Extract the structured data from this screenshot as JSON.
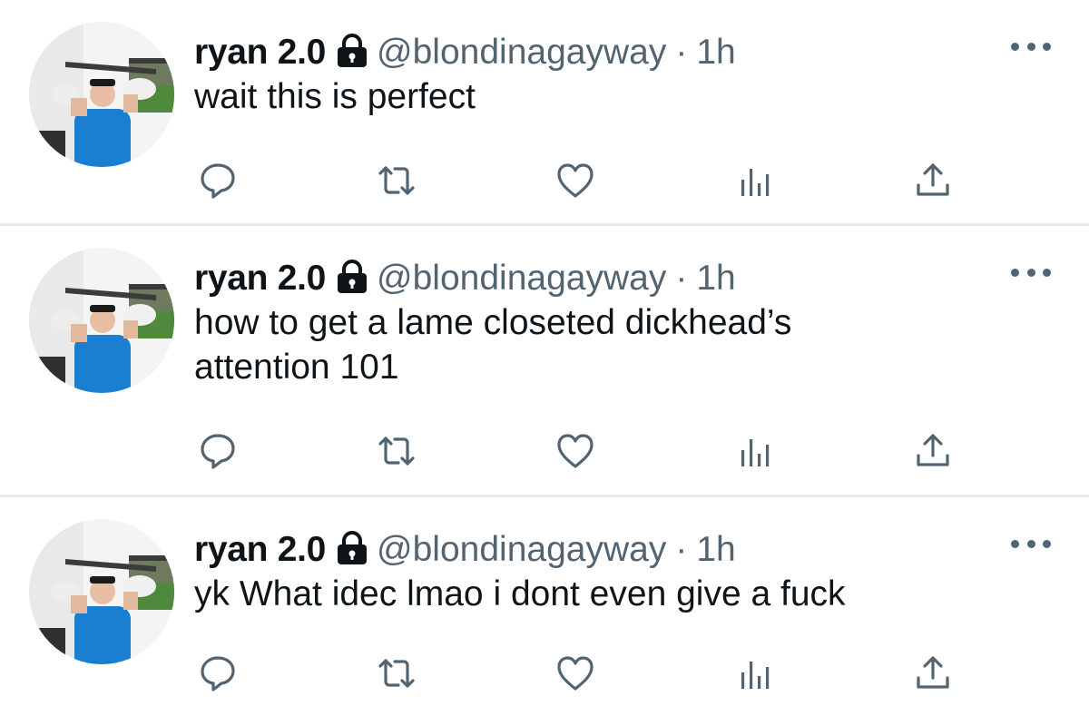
{
  "colors": {
    "name": "#0f1419",
    "secondary": "#536471",
    "divider": "#e8eaed",
    "background": "#ffffff"
  },
  "icons": {
    "protected": "lock-icon",
    "more": "more-icon",
    "reply": "reply-icon",
    "retweet": "retweet-icon",
    "like": "heart-icon",
    "views": "views-icon",
    "share": "share-icon"
  },
  "tweets": [
    {
      "display_name": "ryan 2.0",
      "handle": "@blondinagayway",
      "separator": "·",
      "time": "1h",
      "lines": [
        "wait this is perfect"
      ]
    },
    {
      "display_name": "ryan 2.0",
      "handle": "@blondinagayway",
      "separator": "·",
      "time": "1h",
      "lines": [
        "how to get a lame closeted dickhead’s",
        "attention 101"
      ]
    },
    {
      "display_name": "ryan 2.0",
      "handle": "@blondinagayway",
      "separator": "·",
      "time": "1h",
      "lines": [
        "yk What idec lmao i dont even give a fuck"
      ]
    }
  ]
}
